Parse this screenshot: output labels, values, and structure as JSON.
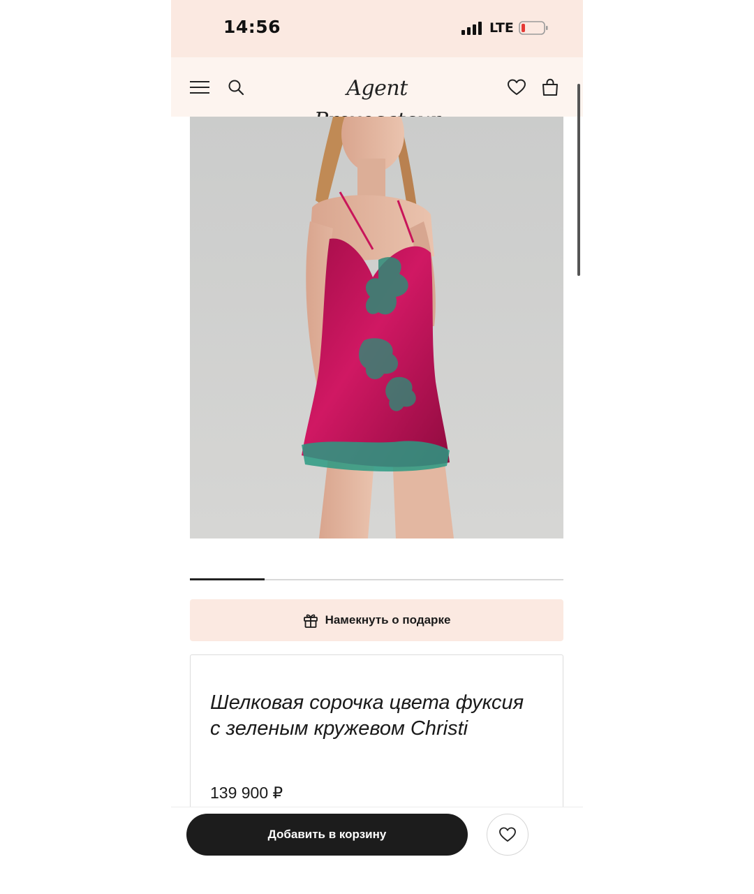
{
  "status_bar": {
    "time": "14:56",
    "network": "LTE",
    "battery_color": "#e53935"
  },
  "header": {
    "logo": "Agent Provocateur",
    "icons": [
      "menu-icon",
      "search-icon",
      "heart-icon",
      "shopping-bag-icon"
    ]
  },
  "gallery": {
    "image_description_icon": "product-photo",
    "progress": 0.2
  },
  "gift_hint": {
    "label": "Намекнуть о подарке",
    "icon": "gift-icon"
  },
  "product": {
    "title": "Шелковая сорочка цвета фуксия с зеленым кружевом Christi",
    "price": "139 900 ₽"
  },
  "actions": {
    "add_to_cart": "Добавить в корзину",
    "wishlist_icon": "heart-icon"
  },
  "colors": {
    "accent_bg": "#fbe9e1",
    "header_bg": "#fdf4ef",
    "primary_button": "#1c1c1c"
  }
}
